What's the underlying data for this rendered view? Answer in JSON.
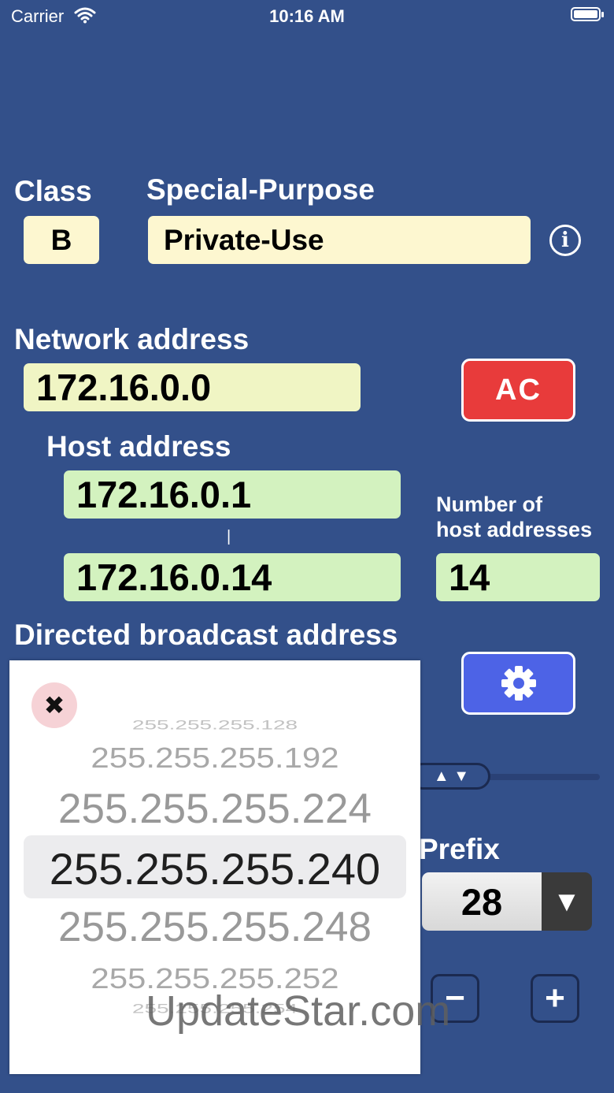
{
  "status_bar": {
    "carrier": "Carrier",
    "time": "10:16 AM"
  },
  "class": {
    "label": "Class",
    "value": "B"
  },
  "special_purpose": {
    "label": "Special-Purpose",
    "value": "Private-Use"
  },
  "network": {
    "label": "Network address",
    "value": "172.16.0.0",
    "ac_button": "AC"
  },
  "host": {
    "label": "Host address",
    "first": "172.16.0.1",
    "separator": "|",
    "last": "172.16.0.14",
    "count_label_line1": "Number of",
    "count_label_line2": "host addresses",
    "count": "14"
  },
  "broadcast": {
    "label": "Directed broadcast address"
  },
  "prefix": {
    "label": "Prefix",
    "value": "28",
    "dropdown_arrow": "▼",
    "minus": "−",
    "plus": "+"
  },
  "subnet_picker": {
    "close": "✖",
    "options": [
      "255.255.255.128",
      "255.255.255.192",
      "255.255.255.224",
      "255.255.255.240",
      "255.255.255.248",
      "255.255.255.252",
      "255.255.255.254"
    ],
    "selected": "255.255.255.240"
  },
  "slider_arrows": "▲ ▼",
  "watermark": "UpdateStar.com",
  "colors": {
    "background": "#33508a",
    "ac_button": "#e83b3b",
    "settings_button": "#4d63e6",
    "field_yellow": "#fdf7d0",
    "field_green": "#d3f2bf"
  }
}
